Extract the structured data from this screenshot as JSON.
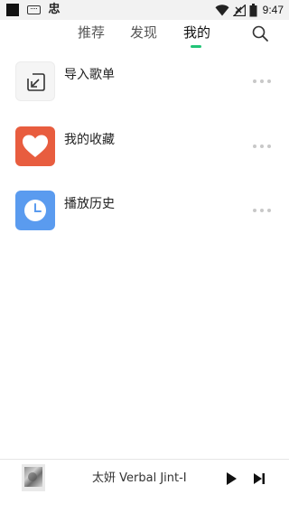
{
  "status_bar": {
    "time": "9:47",
    "icons": [
      "app-square-icon",
      "keyboard-icon",
      "app-char-icon",
      "wifi-icon",
      "signal-icon",
      "battery-icon"
    ],
    "app_char": "忠"
  },
  "nav": {
    "tabs": [
      {
        "label": "推荐"
      },
      {
        "label": "发现"
      },
      {
        "label": "我的"
      }
    ],
    "active_tab": "我的",
    "accent_color": "#22c477",
    "search_icon": "search-icon"
  },
  "list": {
    "items": [
      {
        "label": "导入歌单",
        "icon": "import-icon",
        "color": "#f5f5f5"
      },
      {
        "label": "我的收藏",
        "icon": "heart-icon",
        "color": "#e85d3f"
      },
      {
        "label": "播放历史",
        "icon": "clock-icon",
        "color": "#5a9bef"
      }
    ],
    "more_icon": "more-dots-icon"
  },
  "player": {
    "track": "太妍  Verbal Jint-I",
    "controls": [
      "play-icon",
      "next-icon"
    ]
  }
}
